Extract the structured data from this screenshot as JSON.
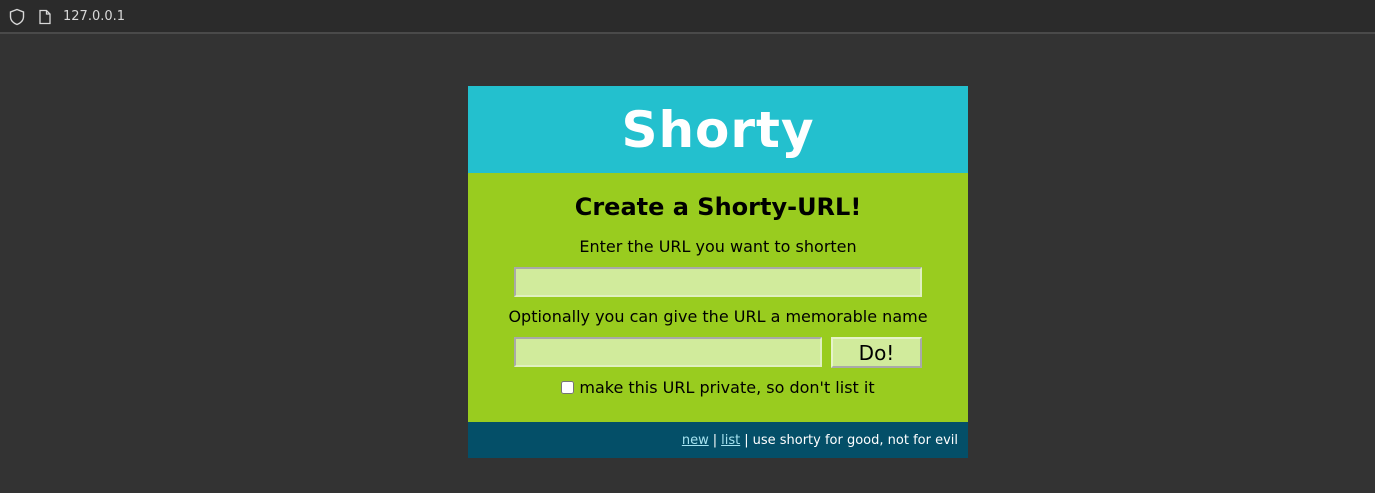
{
  "browser": {
    "url": "127.0.0.1",
    "icons": [
      "shield-icon",
      "page-icon"
    ]
  },
  "header": {
    "title": "Shorty"
  },
  "form": {
    "heading": "Create a Shorty-URL!",
    "url_label": "Enter the URL you want to shorten",
    "url_value": "",
    "name_label": "Optionally you can give the URL a memorable name",
    "name_value": "",
    "submit_label": "Do!",
    "private_label": "make this URL private, so don't list it",
    "private_checked": false
  },
  "footer": {
    "link_new": "new",
    "link_list": "list",
    "separator": "|",
    "tagline": "use shorty for good, not for evil"
  },
  "colors": {
    "page_bg": "#333333",
    "header_bg": "#23c0ce",
    "body_bg": "#99cc1f",
    "input_bg": "#d1eb9c",
    "footer_bg": "#044f68",
    "footer_link": "#a6e3f0"
  }
}
